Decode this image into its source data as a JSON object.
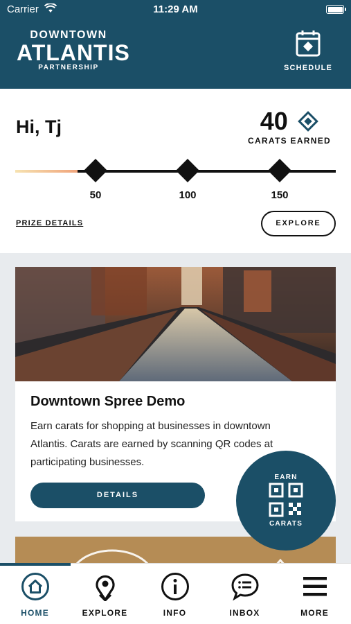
{
  "status_bar": {
    "carrier": "Carrier",
    "time": "11:29 AM"
  },
  "header": {
    "logo_line1": "DOWNTOWN",
    "logo_line2": "ATLANTIS",
    "logo_line3": "PARTNERSHIP",
    "schedule_label": "SCHEDULE"
  },
  "progress": {
    "greeting": "Hi, Tj",
    "carats": "40",
    "carats_label": "CARATS EARNED",
    "milestones": [
      "50",
      "100",
      "150"
    ],
    "progress_value": 40,
    "prize_details_label": "PRIZE DETAILS",
    "explore_label": "EXPLORE"
  },
  "event": {
    "title": "Downtown Spree Demo",
    "description": "Earn carats for shopping at businesses in downtown Atlantis. Carats are earned by scanning QR codes at participating businesses.",
    "details_label": "DETAILS"
  },
  "fab": {
    "top_label": "EARN",
    "bottom_label": "CARATS"
  },
  "tabs": [
    {
      "label": "HOME",
      "icon": "home-icon"
    },
    {
      "label": "EXPLORE",
      "icon": "map-pin-icon"
    },
    {
      "label": "INFO",
      "icon": "info-icon"
    },
    {
      "label": "INBOX",
      "icon": "chat-icon"
    },
    {
      "label": "MORE",
      "icon": "menu-icon"
    }
  ],
  "colors": {
    "brand": "#1b4f67",
    "accent_gold": "#b58c55"
  }
}
